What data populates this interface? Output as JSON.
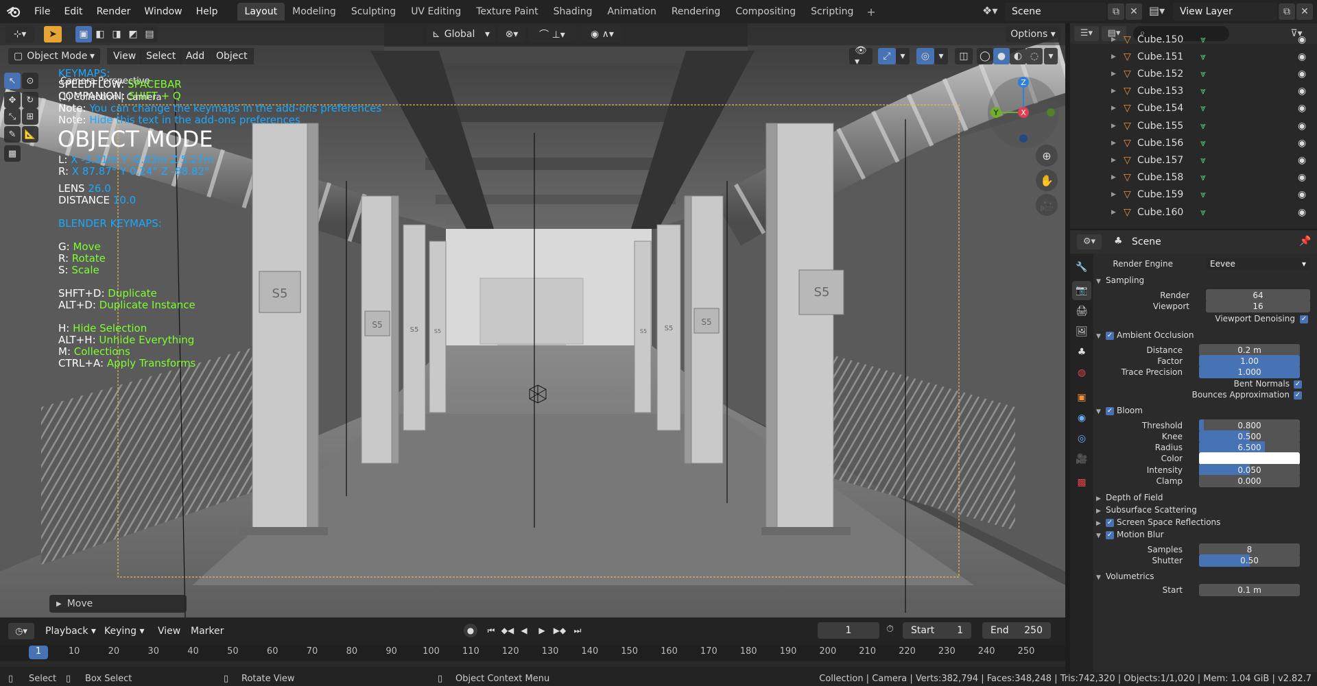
{
  "topbar": {
    "menus": [
      "File",
      "Edit",
      "Render",
      "Window",
      "Help"
    ],
    "workspaces": [
      "Layout",
      "Modeling",
      "Sculpting",
      "UV Editing",
      "Texture Paint",
      "Shading",
      "Animation",
      "Rendering",
      "Compositing",
      "Scripting"
    ],
    "active_workspace": "Layout",
    "scene": "Scene",
    "view_layer": "View Layer"
  },
  "viewport": {
    "transform_orientation": "Global",
    "options": "Options",
    "mode": "Object Mode",
    "menus": [
      "View",
      "Select",
      "Add",
      "Object"
    ],
    "camera_perspective": "Camera Perspective",
    "camera_name": "(1) Collection | Camera",
    "keymaps_title": "KEYMAPS:",
    "speedflow_label": "SPEEDFLOW:",
    "speedflow_value": "SPACEBAR",
    "companion_label": "COMPANION:",
    "companion_value": "SHIFT + Q",
    "note1_label": "Note:",
    "note1_value": "You can change the keymaps in the add-ons preferences",
    "note2_label": "Note:",
    "note2_value": "Hide this text in the add-ons preferences",
    "mode_title": "OBJECT MODE",
    "loc_label": "L:",
    "loc_value": "X -3.31m Y -0.03m Z 5.27m",
    "rot_label": "R:",
    "rot_value": "X 87.87° Y 0.24° Z -88.82°",
    "lens_label": "LENS",
    "lens_value": "26.0",
    "distance_label": "DISTANCE",
    "distance_value": "10.0",
    "blender_keymaps": "BLENDER KEYMAPS:",
    "keys": [
      {
        "key": "G:",
        "action": "Move"
      },
      {
        "key": "R:",
        "action": "Rotate"
      },
      {
        "key": "S:",
        "action": "Scale"
      },
      {
        "key": "SHFT+D:",
        "action": "Duplicate"
      },
      {
        "key": "ALT+D:",
        "action": "Duplicate Instance"
      },
      {
        "key": "H:",
        "action": "Hide Selection"
      },
      {
        "key": "ALT+H:",
        "action": "Unhide Everything"
      },
      {
        "key": "M:",
        "action": "Collections"
      },
      {
        "key": "CTRL+A:",
        "action": "Apply Transforms"
      }
    ],
    "last_operator": "Move",
    "gizmo_x": "X",
    "gizmo_y": "Y",
    "gizmo_z": "Z",
    "pillar_labels": [
      "S5",
      "S5",
      "S5",
      "S5",
      "S5",
      "S5",
      "S5",
      "S5"
    ]
  },
  "timeline": {
    "menus": [
      "Playback",
      "Keying",
      "View",
      "Marker"
    ],
    "current_frame": "1",
    "start_label": "Start",
    "start_value": "1",
    "end_label": "End",
    "end_value": "250",
    "ticks": [
      "1",
      "10",
      "20",
      "30",
      "40",
      "50",
      "60",
      "70",
      "80",
      "90",
      "100",
      "110",
      "120",
      "130",
      "140",
      "150",
      "160",
      "170",
      "180",
      "190",
      "200",
      "210",
      "220",
      "230",
      "240",
      "250"
    ]
  },
  "status": {
    "select": "Select",
    "box_select": "Box Select",
    "rotate_view": "Rotate View",
    "context_menu": "Object Context Menu",
    "stats": "Collection | Camera | Verts:382,794 | Faces:348,248 | Tris:742,320 | Objects:1/1,020 | Mem: 1.04 GiB | v2.82.7"
  },
  "outliner": {
    "items": [
      "Cube.150",
      "Cube.151",
      "Cube.152",
      "Cube.153",
      "Cube.154",
      "Cube.155",
      "Cube.156",
      "Cube.157",
      "Cube.158",
      "Cube.159",
      "Cube.160"
    ]
  },
  "properties": {
    "context": "Scene",
    "render_engine_label": "Render Engine",
    "render_engine": "Eevee",
    "sampling": {
      "title": "Sampling",
      "render_label": "Render",
      "render": "64",
      "viewport_label": "Viewport",
      "viewport": "16",
      "denoise_label": "Viewport Denoising"
    },
    "ao": {
      "title": "Ambient Occlusion",
      "distance_label": "Distance",
      "distance": "0.2 m",
      "factor_label": "Factor",
      "factor": "1.00",
      "trace_label": "Trace Precision",
      "trace": "1.000",
      "bent_label": "Bent Normals",
      "bounces_label": "Bounces Approximation"
    },
    "bloom": {
      "title": "Bloom",
      "threshold_label": "Threshold",
      "threshold": "0.800",
      "knee_label": "Knee",
      "knee": "0.500",
      "radius_label": "Radius",
      "radius": "6.500",
      "color_label": "Color",
      "intensity_label": "Intensity",
      "intensity": "0.050",
      "clamp_label": "Clamp",
      "clamp": "0.000"
    },
    "dof": "Depth of Field",
    "sss": "Subsurface Scattering",
    "ssr": "Screen Space Reflections",
    "motion_blur": {
      "title": "Motion Blur",
      "samples_label": "Samples",
      "samples": "8",
      "shutter_label": "Shutter",
      "shutter": "0.50"
    },
    "volumetrics": {
      "title": "Volumetrics",
      "start_label": "Start",
      "start": "0.1 m"
    }
  }
}
